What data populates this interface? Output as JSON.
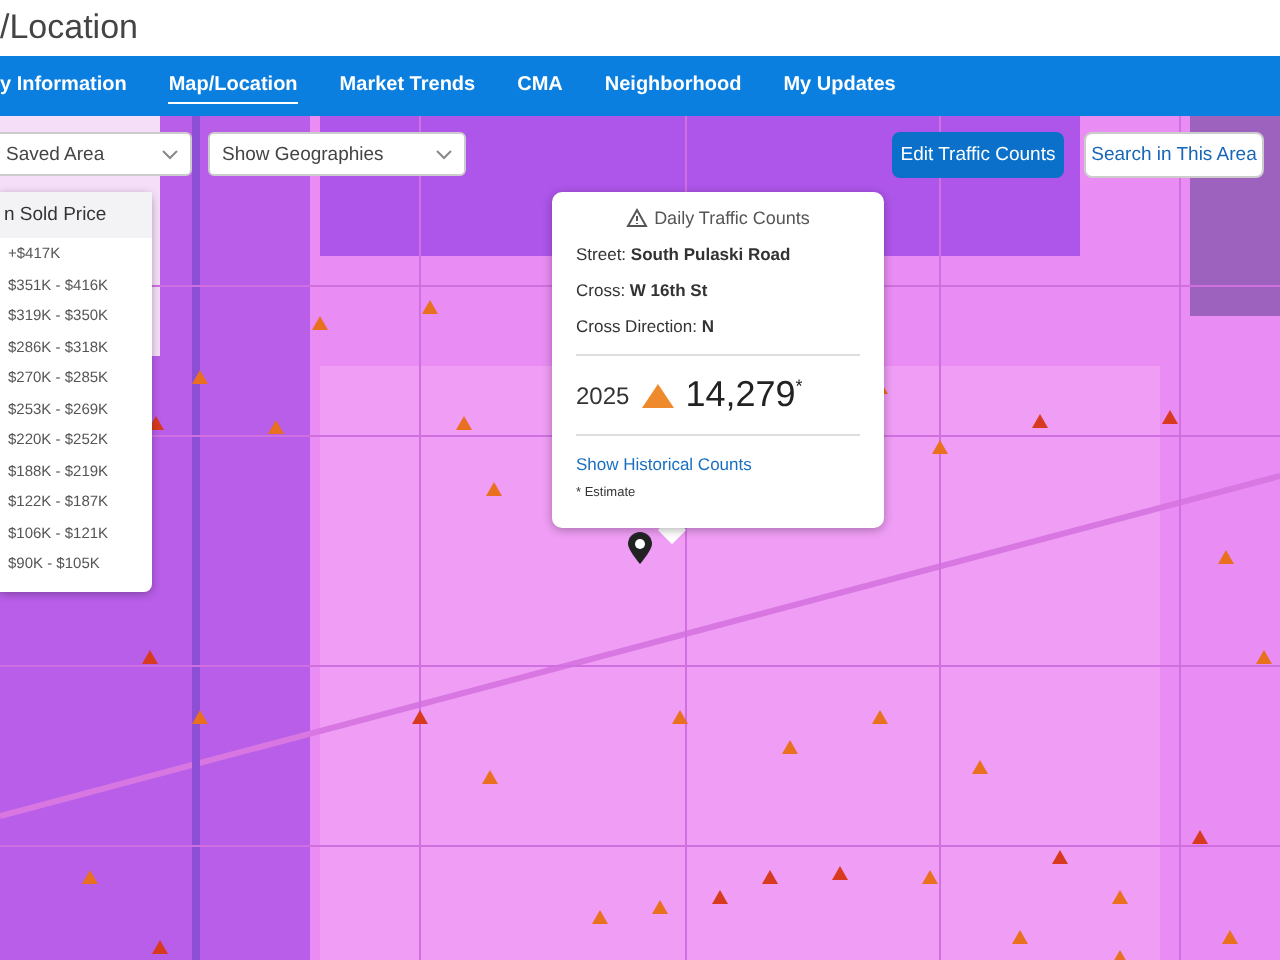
{
  "page_title": "/Location",
  "nav_tabs": [
    {
      "label": "y Information",
      "selected": false
    },
    {
      "label": "Map/Location",
      "selected": true
    },
    {
      "label": "Market Trends",
      "selected": false
    },
    {
      "label": "CMA",
      "selected": false
    },
    {
      "label": "Neighborhood",
      "selected": false
    },
    {
      "label": "My Updates",
      "selected": false
    }
  ],
  "map_controls": {
    "dropdowns": [
      "Saved Area",
      "Show Geographies"
    ],
    "buttons": [
      {
        "label": "Edit Traffic Counts",
        "kind": "primary"
      },
      {
        "label": "Search in This Area",
        "kind": "secondary"
      }
    ]
  },
  "legend": {
    "title": "n Sold Price",
    "items": [
      {
        "label": "+$417K"
      },
      {
        "label": "$351K - $416K"
      },
      {
        "label": "$319K - $350K"
      },
      {
        "label": "$286K - $318K"
      },
      {
        "label": "$270K - $285K"
      },
      {
        "label": "$253K - $269K"
      },
      {
        "label": "$220K - $252K"
      },
      {
        "label": "$188K - $219K"
      },
      {
        "label": "$122K - $187K"
      },
      {
        "label": "$106K - $121K"
      },
      {
        "label": "$90K - $105K"
      }
    ]
  },
  "popup": {
    "title": "Daily Traffic Counts",
    "fields": [
      {
        "label": "Street:",
        "value": "South Pulaski Road"
      },
      {
        "label": "Cross:",
        "value": "W 16th St"
      },
      {
        "label": "Cross Direction:",
        "value": "N"
      }
    ],
    "year": "2025",
    "count": "14,279$^{*}$",
    "link": "Show Historical Counts",
    "note": "* Estimate"
  }
}
